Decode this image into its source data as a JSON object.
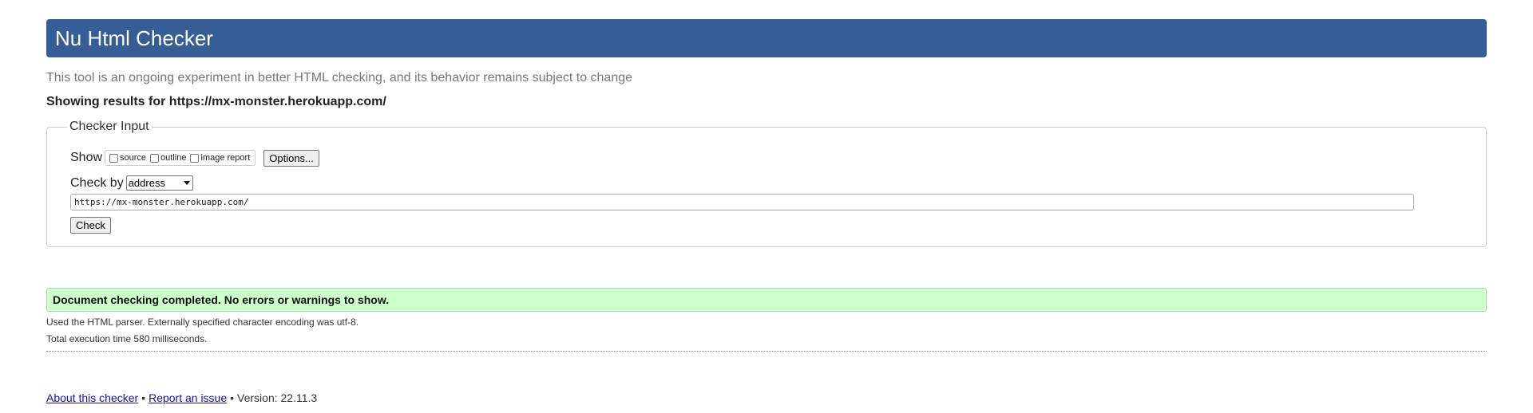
{
  "header": {
    "title": "Nu Html Checker"
  },
  "tagline": "This tool is an ongoing experiment in better HTML checking, and its behavior remains subject to change",
  "showing_results": "Showing results for https://mx-monster.herokuapp.com/",
  "checker_input": {
    "legend": "Checker Input",
    "show_label": "Show",
    "show_options": [
      {
        "label": "source",
        "checked": false
      },
      {
        "label": "outline",
        "checked": false
      },
      {
        "label": "image report",
        "checked": false
      }
    ],
    "options_button": "Options...",
    "check_by_label": "Check by",
    "check_by_value": "address",
    "url_value": "https://mx-monster.herokuapp.com/",
    "check_button": "Check"
  },
  "result": {
    "message": "Document checking completed. No errors or warnings to show.",
    "parser_info": "Used the HTML parser. Externally specified character encoding was utf-8.",
    "execution_time": "Total execution time 580 milliseconds."
  },
  "footer": {
    "about_link": "About this checker",
    "separator": "•",
    "report_link": "Report an issue",
    "version": "Version: 22.11.3"
  },
  "colors": {
    "header_bg": "#365d95",
    "success_bg": "#ccffcc",
    "link": "#1a0dab"
  }
}
